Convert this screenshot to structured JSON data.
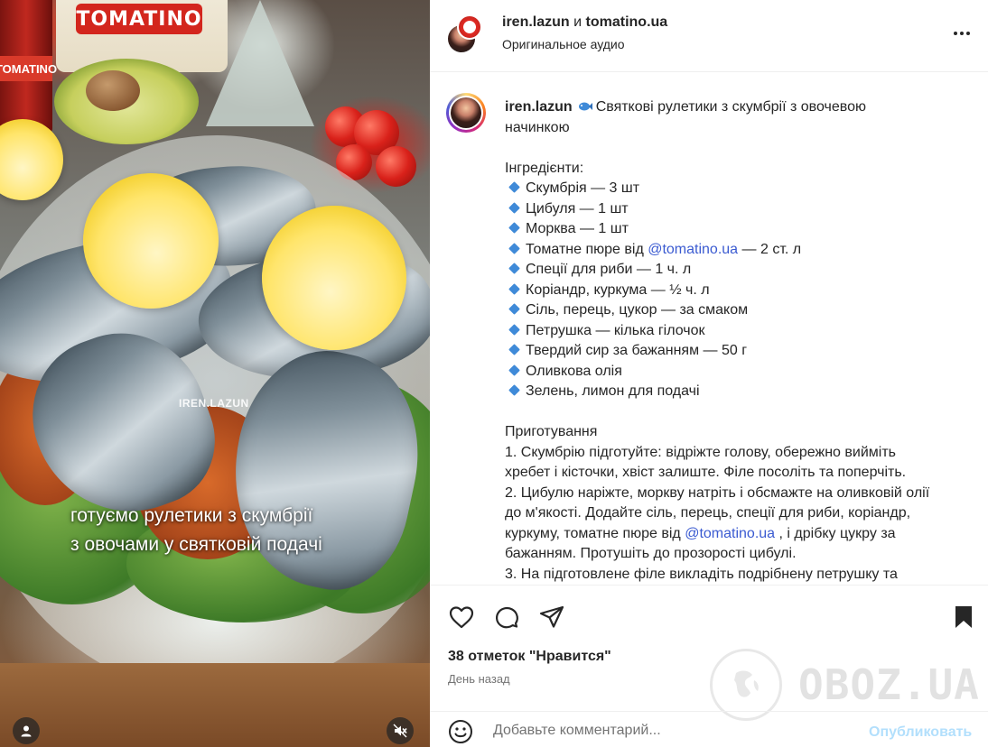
{
  "media": {
    "brand_logo": "TOMATINO",
    "jar_label": "TOMATINO",
    "watermark": "IREN.LAZUN",
    "overlay_lines": [
      "готуємо рулетики з скумбрії",
      "з овочами у святковій подачі"
    ],
    "icons": {
      "account": "user-icon",
      "sound": "muted-speaker-icon"
    }
  },
  "header": {
    "author": "iren.lazun",
    "connector": "и",
    "coauthor": "tomatino.ua",
    "audio": "Оригинальное аудио",
    "more_icon": "more-horizontal-icon"
  },
  "caption": {
    "user": "iren.lazun",
    "title_line1": "Святкові рулетики з скумбрії з овочевою",
    "title_line2": "начинкою",
    "ingredients_heading": "Інгредієнти:",
    "ingredients": [
      {
        "text": "Скумбрія — 3 шт"
      },
      {
        "text": "Цибуля — 1 шт"
      },
      {
        "text": "Морква — 1 шт"
      },
      {
        "pre": "Томатне пюре від ",
        "mention": "@tomatino.ua",
        "post": " — 2 ст. л"
      },
      {
        "text": "Спеції для риби — 1 ч. л"
      },
      {
        "text": "Коріандр, куркума — ½ ч. л"
      },
      {
        "text": "Сіль, перець, цукор — за смаком"
      },
      {
        "text": "Петрушка — кілька гілочок"
      },
      {
        "text": "Твердий сир за бажанням — 50 г"
      },
      {
        "text": "Оливкова олія"
      },
      {
        "text": "Зелень, лимон для подачі"
      }
    ],
    "prep_heading": "Приготування",
    "step1_a": "1. Скумбрію підготуйте: відріжте голову, обережно вийміть",
    "step1_b": "хребет і кісточки, хвіст залиште. Філе посоліть та поперчіть.",
    "step2_a": "2. Цибулю наріжте, моркву натріть і обсмажте на оливковій олії",
    "step2_b": "до м'якості. Додайте сіль, перець, спеції для риби, коріандр,",
    "step2_c_pre": "куркуму, томатне пюре від ",
    "step2_c_mention": "@tomatino.ua",
    "step2_c_post": " , і дрібку цукру за",
    "step2_d": "бажанням. Протушіть до прозорості цибулі.",
    "step3_a": "3. На підготовлене філе викладіть подрібнену петрушку та"
  },
  "actions": {
    "icons": [
      "heart-icon",
      "comment-icon",
      "share-icon",
      "bookmark-icon"
    ],
    "likes": "38 отметок \"Нравится\"",
    "date": "День назад"
  },
  "watermark": {
    "text": "OBOZ.UA"
  },
  "comment": {
    "emoji_icon": "emoji-icon",
    "placeholder": "Добавьте комментарий...",
    "publish": "Опубликовать"
  },
  "colors": {
    "mention": "#3b5bd1",
    "publish_disabled": "#b2dffc",
    "bullet": "#3f8ad8"
  }
}
